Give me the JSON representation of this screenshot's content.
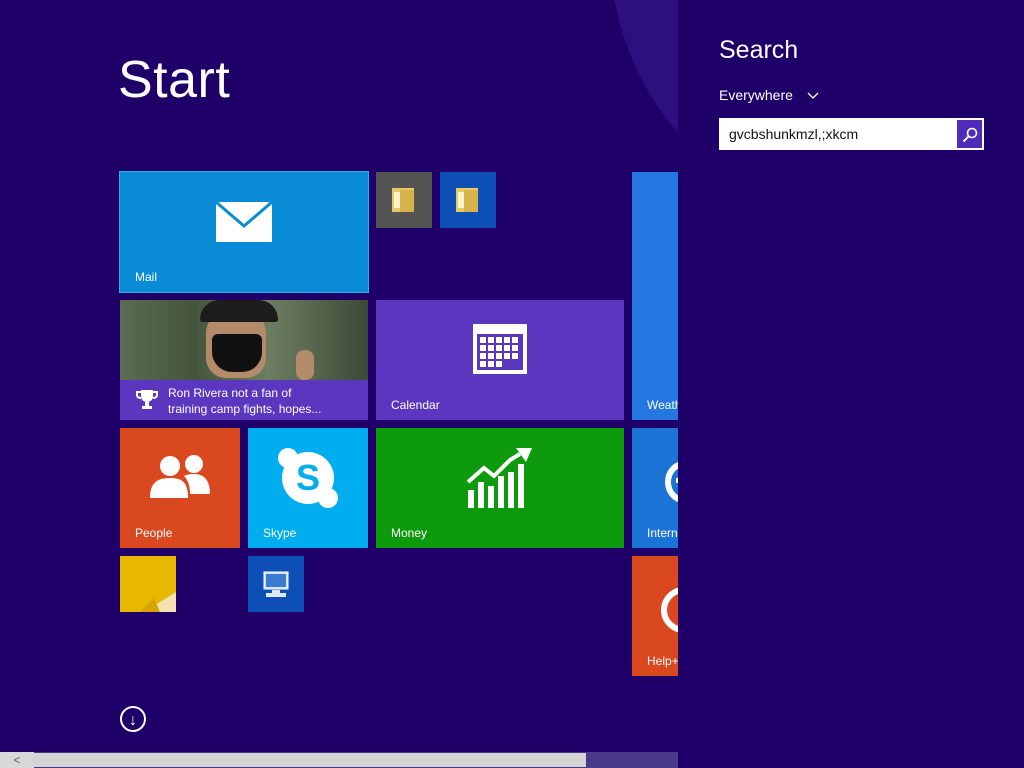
{
  "start": {
    "title": "Start",
    "tiles": {
      "mail": "Mail",
      "news_headline_line1": "Ron Rivera not a fan of",
      "news_headline_line2": "training camp fights, hopes...",
      "calendar": "Calendar",
      "people": "People",
      "skype": "Skype",
      "money": "Money",
      "weather_partial": "Weath",
      "ie_partial": "Intern",
      "help_partial": "Help+"
    },
    "scroll_down_glyph": "↓",
    "scroll_left_glyph": "<"
  },
  "search_charm": {
    "title": "Search",
    "scope": "Everywhere",
    "scope_chevron": "⌵",
    "query": "gvcbshunkmzl,;xkcm"
  },
  "colors": {
    "background": "#1f0068",
    "mail": "#0a8bd6",
    "calendar": "#5b37c0",
    "people": "#d9481e",
    "skype": "#00adef",
    "money": "#0d9a0d",
    "weather": "#2477e0"
  }
}
